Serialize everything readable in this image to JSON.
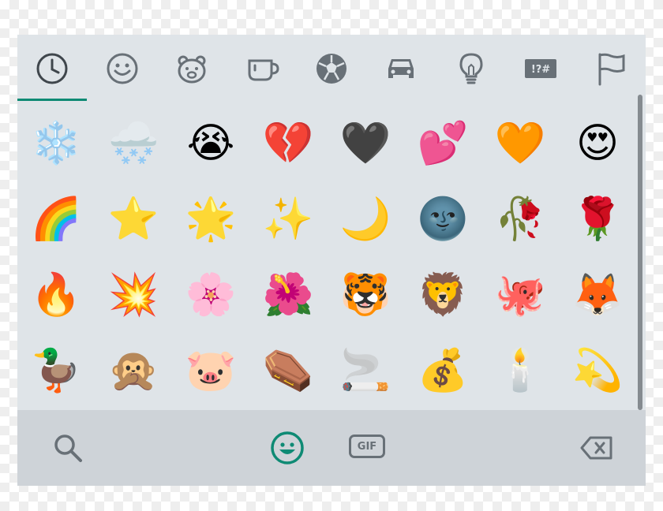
{
  "colors": {
    "panel_bg": "#dfe4e8",
    "bottom_bg": "#ced3d8",
    "icon_gray": "#687077",
    "accent_teal": "#0e8a74"
  },
  "categories": [
    {
      "icon": "clock-icon",
      "active": true
    },
    {
      "icon": "smiley-icon",
      "active": false
    },
    {
      "icon": "bear-icon",
      "active": false
    },
    {
      "icon": "cup-icon",
      "active": false
    },
    {
      "icon": "soccer-ball-icon",
      "active": false
    },
    {
      "icon": "car-icon",
      "active": false
    },
    {
      "icon": "lightbulb-icon",
      "active": false
    },
    {
      "icon": "symbols-icon",
      "active": false,
      "label": "!?#"
    },
    {
      "icon": "flag-icon",
      "active": false
    }
  ],
  "emojis": [
    "❄️",
    "🌨️",
    "😭",
    "💔",
    "🖤",
    "💕",
    "🧡",
    "😍",
    "🌈",
    "⭐",
    "🌟",
    "✨",
    "🌙",
    "🌚",
    "🥀",
    "🌹",
    "🔥",
    "💥",
    "🌸",
    "🌺",
    "🐯",
    "🦁",
    "🐙",
    "🦊",
    "🦆",
    "🙊",
    "🐷",
    "⚰️",
    "🚬",
    "💰",
    "🕯️",
    "💫"
  ],
  "bottom": {
    "search_icon": "search-icon",
    "emoji_icon": "smiley-icon",
    "gif_label": "GIF",
    "backspace_icon": "backspace-icon"
  }
}
